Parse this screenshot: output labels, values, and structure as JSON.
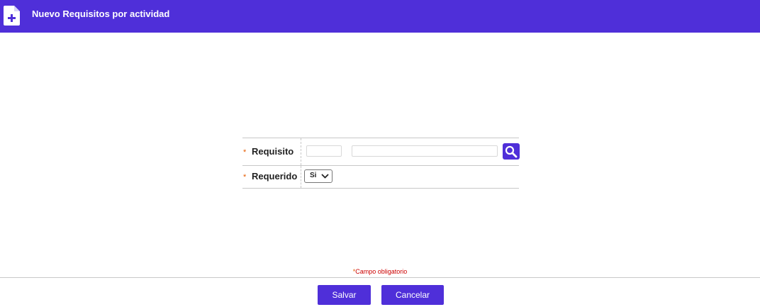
{
  "header": {
    "title": "Nuevo Requisitos por actividad",
    "icon": "file-add-icon"
  },
  "form": {
    "fields": [
      {
        "required_mark": "*",
        "label": "Requisito",
        "code_value": "",
        "description_value": "",
        "action_icon": "search-icon"
      },
      {
        "required_mark": "*",
        "label": "Requerido",
        "selected_option": "Si"
      }
    ]
  },
  "required_note": {
    "mark": "*",
    "text": "Campo obligatorio"
  },
  "buttons": {
    "save_label": "Salvar",
    "cancel_label": "Cancelar"
  },
  "colors": {
    "accent": "#4f2fd9",
    "required": "#e65c00",
    "note": "#cc0000"
  }
}
